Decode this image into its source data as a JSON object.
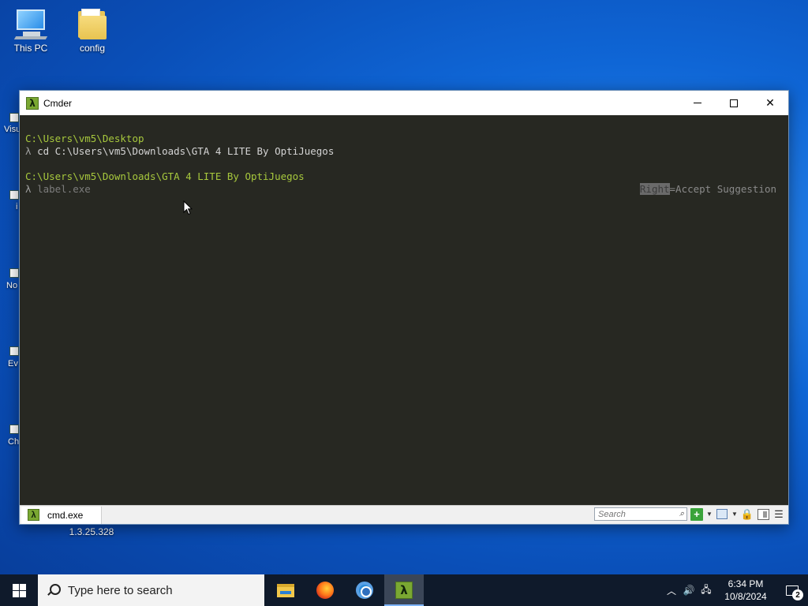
{
  "desktop": {
    "icons": [
      {
        "label": "This PC",
        "icon": "computer-icon"
      },
      {
        "label": "config",
        "icon": "folder-icon"
      }
    ],
    "partial_labels": [
      "Visu",
      "i",
      "No",
      "Ev",
      "Ch"
    ],
    "below_window_label": "1.3.25.328"
  },
  "window": {
    "title": "Cmder",
    "app_icon_glyph": "λ",
    "controls": {
      "minimize": "minimize-icon",
      "maximize": "maximize-icon",
      "close": "✕"
    }
  },
  "terminal": {
    "lines": [
      {
        "type": "path",
        "text": "C:\\Users\\vm5\\Desktop"
      },
      {
        "type": "cmd",
        "prompt": "λ",
        "text": "cd C:\\Users\\vm5\\Downloads\\GTA 4 LITE By OptiJuegos"
      },
      {
        "type": "blank",
        "text": ""
      },
      {
        "type": "path",
        "text": "C:\\Users\\vm5\\Downloads\\GTA 4 LITE By OptiJuegos"
      },
      {
        "type": "cmd",
        "prompt": "λ",
        "text": "label.exe"
      }
    ],
    "hint": {
      "key": "Right",
      "text": "=Accept Suggestion"
    },
    "colors": {
      "background": "#272822",
      "path": "#a7c83d",
      "text": "#d4d4d4"
    }
  },
  "statusbar": {
    "tab_label": "cmd.exe",
    "search_placeholder": "Search"
  },
  "taskbar": {
    "search_placeholder": "Type here to search",
    "apps": [
      "file-explorer-icon",
      "firefox-icon",
      "chrome-icon",
      "cmder-icon"
    ],
    "time": "6:34 PM",
    "date": "10/8/2024",
    "notification_count": "2"
  }
}
